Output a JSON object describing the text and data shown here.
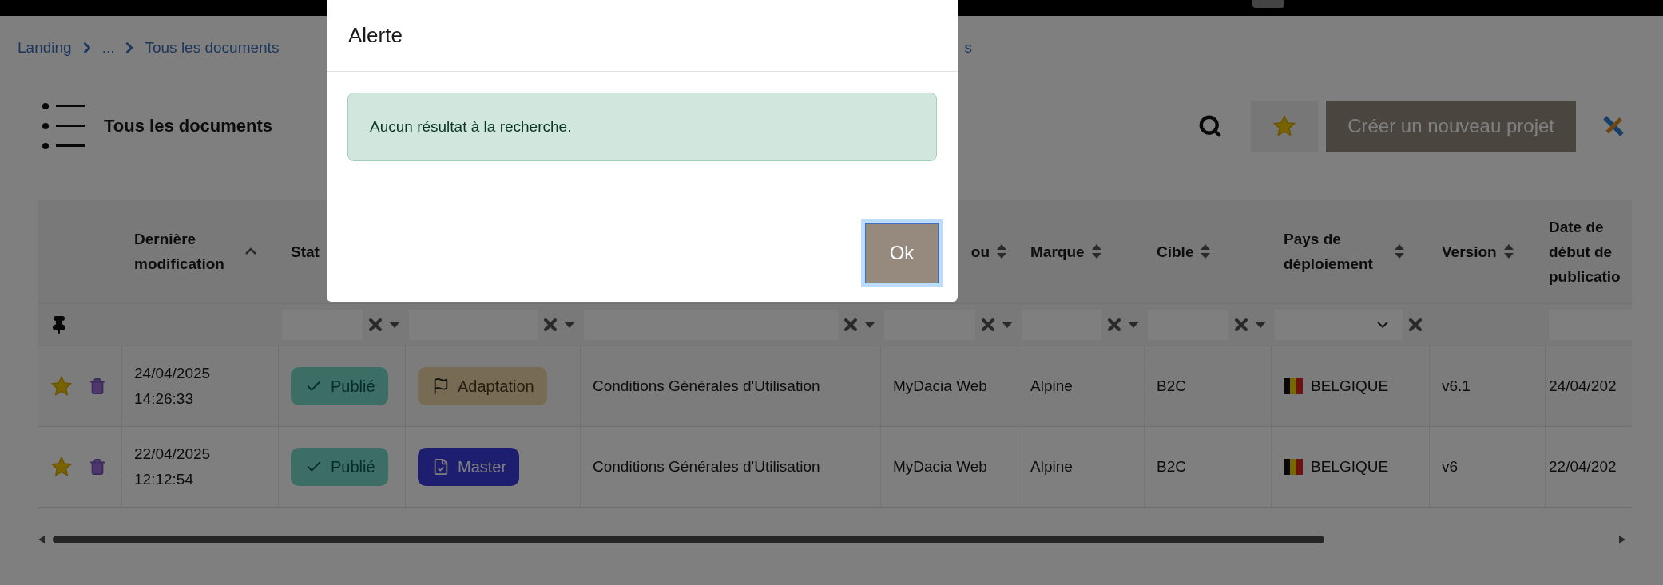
{
  "breadcrumb": [
    {
      "label": "Landing"
    },
    {
      "label": "..."
    },
    {
      "label": "Tous les documents"
    }
  ],
  "breadcrumb_tail": "s",
  "page_title": "Tous les documents",
  "create_button": "Créer un nouveau projet",
  "table": {
    "columns": [
      {
        "filter": {
          "kind": "pin"
        }
      },
      {
        "label": "Dernière modification",
        "sort": {
          "kind": "asc"
        }
      },
      {
        "label": "Stat",
        "filter": {
          "kind": "text"
        }
      },
      {
        "filter": {
          "kind": "text"
        }
      },
      {
        "filter": {
          "kind": "text"
        }
      },
      {
        "label": "ou",
        "sort": {
          "kind": "both"
        },
        "filter": {
          "kind": "text"
        }
      },
      {
        "label": "Marque",
        "sort": {
          "kind": "both"
        },
        "filter": {
          "kind": "text"
        }
      },
      {
        "label": "Cible",
        "sort": {
          "kind": "both"
        },
        "filter": {
          "kind": "text"
        }
      },
      {
        "label": "Pays de déploiement",
        "sort": {
          "kind": "both"
        },
        "filter": {
          "kind": "select"
        }
      },
      {
        "label": "Version",
        "sort": {
          "kind": "both"
        }
      },
      {
        "label": "Date de début de publicatio",
        "filter": {
          "kind": "input"
        }
      }
    ],
    "rows": [
      {
        "favorite": true,
        "date": "24/04/2025",
        "time": "14:26:33",
        "status": "Publié",
        "type": {
          "kind": "adaptation",
          "label": "Adaptation"
        },
        "document": "Conditions Générales d'Utilisation",
        "site": "MyDacia Web",
        "brand": "Alpine",
        "target": "B2C",
        "country": "BELGIQUE",
        "version": "v6.1",
        "publication": "24/04/202"
      },
      {
        "favorite": true,
        "date": "22/04/2025",
        "time": "12:12:54",
        "status": "Publié",
        "type": {
          "kind": "master",
          "label": "Master"
        },
        "document": "Conditions Générales d'Utilisation",
        "site": "MyDacia Web",
        "brand": "Alpine",
        "target": "B2C",
        "country": "BELGIQUE",
        "version": "v6",
        "publication": "22/04/202"
      }
    ]
  },
  "dialog": {
    "title": "Alerte",
    "message": "Aucun résultat à la recherche.",
    "button": "Ok"
  }
}
